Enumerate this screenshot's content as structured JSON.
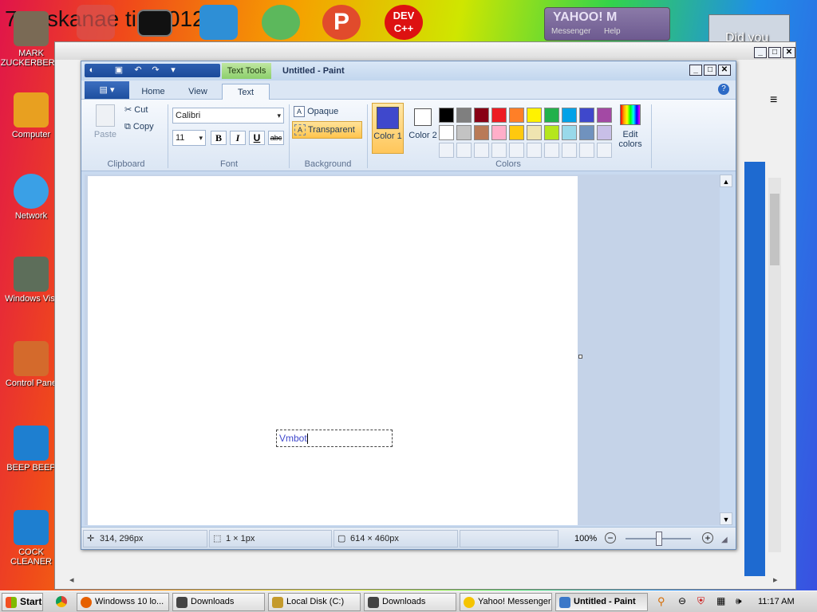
{
  "desktop": {
    "banner_text": "7 osskanae tion 012",
    "icons": [
      {
        "label": "MARK ZUCKERBERG"
      },
      {
        "label": "Computer"
      },
      {
        "label": "Network"
      },
      {
        "label": "Windows Vist"
      },
      {
        "label": "Control Pane"
      },
      {
        "label": "BEEP BEEP"
      },
      {
        "label": "COCK CLEANER"
      }
    ],
    "top_icons": [
      {
        "label": "DEV C++"
      }
    ],
    "yahoo_title": "YAHOO! M",
    "yahoo_sub": "Messenger",
    "yahoo_help": "Help",
    "did_you": "Did you"
  },
  "paint": {
    "title": "Untitled - Paint",
    "context_tab": "Text Tools",
    "tabs": [
      "Home",
      "View",
      "Text"
    ],
    "clipboard": {
      "paste": "Paste",
      "cut": "Cut",
      "copy": "Copy",
      "label": "Clipboard"
    },
    "font": {
      "family": "Calibri",
      "size": "11",
      "label": "Font",
      "bold": "B",
      "italic": "I",
      "underline": "U",
      "strike": "abc"
    },
    "background": {
      "opaque": "Opaque",
      "transparent": "Transparent",
      "label": "Background"
    },
    "colors": {
      "color1": "Color 1",
      "color2": "Color 2",
      "edit": "Edit colors",
      "label": "Colors",
      "color1_value": "#3f48cc",
      "color2_value": "#ffffff",
      "palette_row1": [
        "#000000",
        "#7f7f7f",
        "#880015",
        "#ed1c24",
        "#ff7f27",
        "#fff200",
        "#22b14c",
        "#00a2e8",
        "#3f48cc",
        "#a349a4"
      ],
      "palette_row2": [
        "#ffffff",
        "#c3c3c3",
        "#b97a57",
        "#ffaec9",
        "#ffc90e",
        "#efe4b0",
        "#b5e61d",
        "#99d9ea",
        "#7092be",
        "#c8bfe7"
      ]
    },
    "canvas_text": "Vmbot",
    "status": {
      "position": "314, 296px",
      "selection": "1 × 1px",
      "size": "614 × 460px",
      "zoom": "100%"
    }
  },
  "taskbar": {
    "start": "Start",
    "items": [
      {
        "label": "Windowss 10 lo..."
      },
      {
        "label": "Downloads"
      },
      {
        "label": "Local Disk (C:)"
      },
      {
        "label": "Downloads"
      },
      {
        "label": "Yahoo! Messenger"
      },
      {
        "label": "Untitled - Paint"
      }
    ],
    "clock": "11:17 AM"
  }
}
